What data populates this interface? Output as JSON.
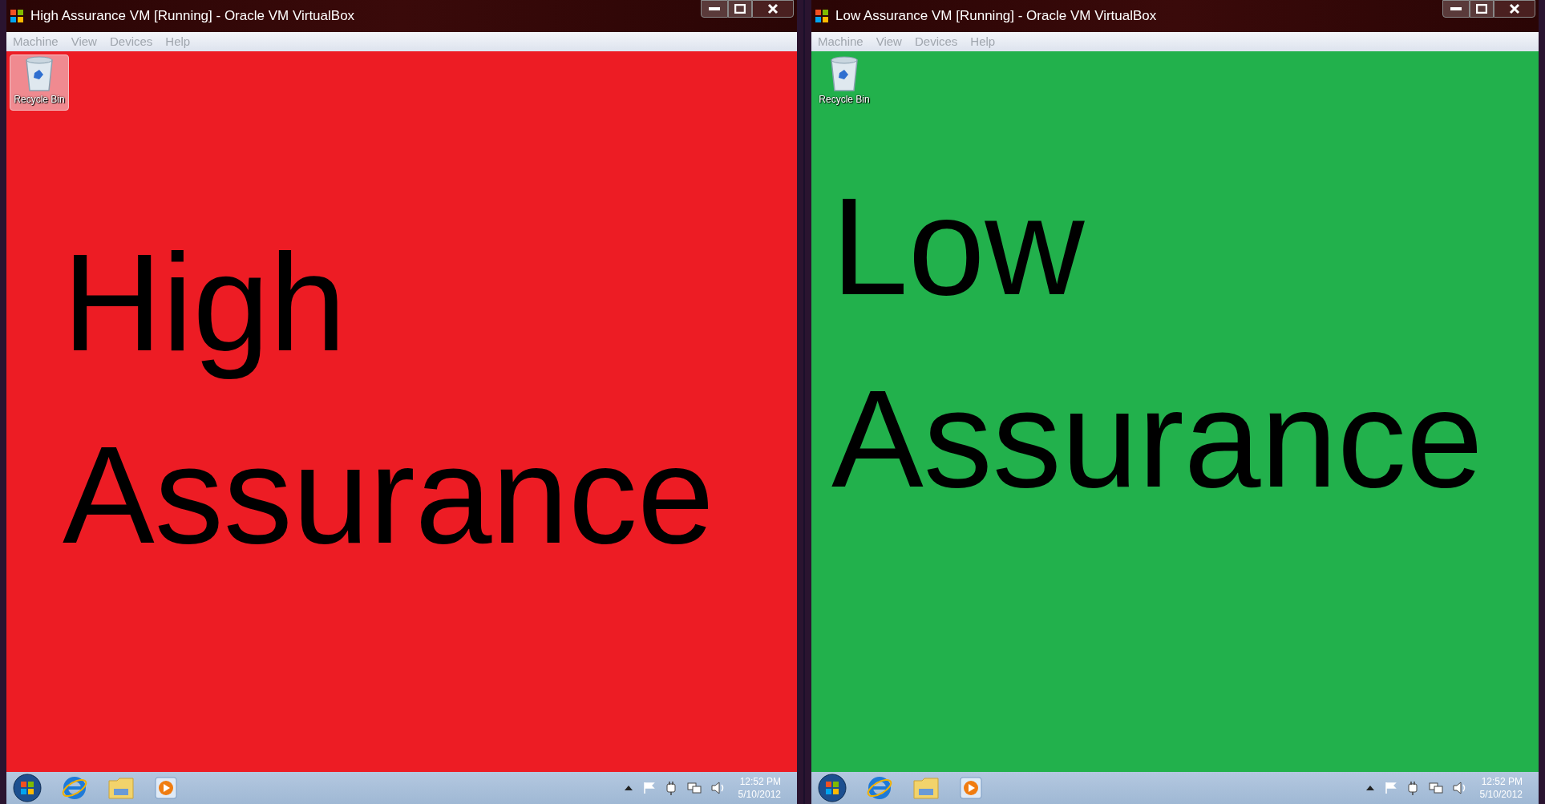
{
  "windows": [
    {
      "title": "High Assurance VM [Running] - Oracle VM VirtualBox",
      "menu": [
        "Machine",
        "View",
        "Devices",
        "Help"
      ],
      "color": "#ed1c24",
      "recycle_bin": {
        "label": "Recycle Bin",
        "selected": true
      },
      "message": [
        "High",
        "Assurance"
      ],
      "taskbar": {
        "time": "12:52 PM",
        "date": "5/10/2012"
      }
    },
    {
      "title": "Low Assurance VM [Running] - Oracle VM VirtualBox",
      "menu": [
        "Machine",
        "View",
        "Devices",
        "Help"
      ],
      "color": "#22b14c",
      "recycle_bin": {
        "label": "Recycle Bin",
        "selected": false
      },
      "message": [
        "Low",
        "Assurance"
      ],
      "taskbar": {
        "time": "12:52 PM",
        "date": "5/10/2012"
      }
    }
  ]
}
